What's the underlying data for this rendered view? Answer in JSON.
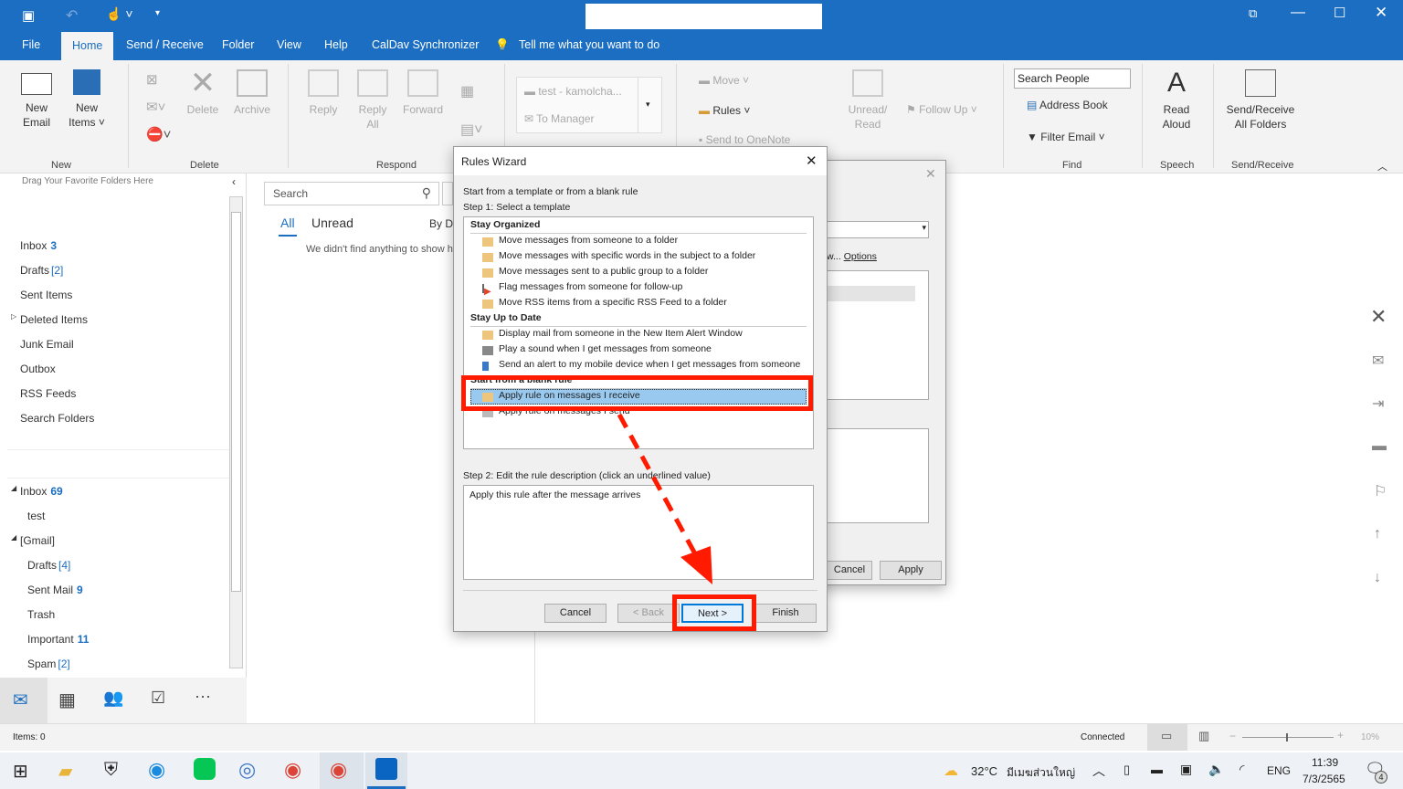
{
  "titlebar": {
    "quick_access": [
      "save-icon",
      "undo-icon",
      "touch-mode-icon",
      "customize-icon"
    ],
    "controls": [
      "restore-ribbon-icon",
      "minimize-icon",
      "maximize-icon",
      "close-icon"
    ]
  },
  "tabs": [
    "File",
    "Home",
    "Send / Receive",
    "Folder",
    "View",
    "Help",
    "CalDav Synchronizer"
  ],
  "tell_me": "Tell me what you want to do",
  "ribbon": {
    "new_email": "New Email",
    "new_items": "New Items",
    "group_new": "New",
    "delete": "Delete",
    "archive": "Archive",
    "group_delete": "Delete",
    "reply": "Reply",
    "reply_all": "Reply All",
    "forward": "Forward",
    "group_respond": "Respond",
    "quick_step1": "test - kamolcha...",
    "quick_step2": "To Manager",
    "move": "Move",
    "rules": "Rules",
    "onenote": "Send to OneNote",
    "unread_read": "Unread/ Read",
    "follow_up": "Follow Up",
    "search_people": "Search People",
    "address_book": "Address Book",
    "filter_email": "Filter Email",
    "group_find": "Find",
    "read_aloud": "Read Aloud",
    "group_speech": "Speech",
    "send_receive_all": "Send/Receive All Folders",
    "group_send_receive": "Send/Receive"
  },
  "folders": {
    "favorites_hint": "Drag Your Favorite Folders Here",
    "account1": [
      {
        "name": "Inbox",
        "count": "3"
      },
      {
        "name": "Drafts",
        "count": "[2]"
      },
      {
        "name": "Sent Items"
      },
      {
        "name": "Deleted Items"
      },
      {
        "name": "Junk Email"
      },
      {
        "name": "Outbox"
      },
      {
        "name": "RSS Feeds"
      },
      {
        "name": "Search Folders"
      }
    ],
    "account2": [
      {
        "name": "Inbox",
        "count": "69"
      },
      {
        "name": "test"
      },
      {
        "name": "[Gmail]"
      },
      {
        "name": "Drafts",
        "count": "[4]"
      },
      {
        "name": "Sent Mail",
        "count": "9"
      },
      {
        "name": "Trash"
      },
      {
        "name": "Important",
        "count": "11"
      },
      {
        "name": "Spam",
        "count": "[2]"
      }
    ]
  },
  "maillist": {
    "search_placeholder": "Search",
    "filter_all": "All",
    "filter_unread": "Unread",
    "sort": "By D",
    "empty": "We didn't find anything to show he"
  },
  "bg_dialog": {
    "options": "Options",
    "cancel": "Cancel",
    "apply": "Apply"
  },
  "wizard": {
    "title": "Rules Wizard",
    "intro": "Start from a template or from a blank rule",
    "step1": "Step 1: Select a template",
    "sections": [
      {
        "header": "Stay Organized",
        "items": [
          "Move messages from someone to a folder",
          "Move messages with specific words in the subject to a folder",
          "Move messages sent to a public group to a folder",
          "Flag messages from someone for follow-up",
          "Move RSS items from a specific RSS Feed to a folder"
        ]
      },
      {
        "header": "Stay Up to Date",
        "items": [
          "Display mail from someone in the New Item Alert Window",
          "Play a sound when I get messages from someone",
          "Send an alert to my mobile device when I get messages from someone"
        ]
      },
      {
        "header": "Start from a blank rule",
        "items": [
          "Apply rule on messages I receive",
          "Apply rule on messages I send"
        ]
      }
    ],
    "selected": "Apply rule on messages I receive",
    "step2": "Step 2: Edit the rule description (click an underlined value)",
    "description": "Apply this rule after the message arrives",
    "cancel": "Cancel",
    "back": "< Back",
    "next": "Next >",
    "finish": "Finish"
  },
  "annotation_color": "#ff1a00",
  "status": {
    "items": "Items: 0",
    "connection": "Connected",
    "zoom": "10%"
  },
  "taskbar": {
    "weather": "32°C",
    "weather_desc": "มีเมฆส่วนใหญ่",
    "lang": "ENG",
    "time": "11:39",
    "date": "7/3/2565",
    "notifications": "4"
  }
}
